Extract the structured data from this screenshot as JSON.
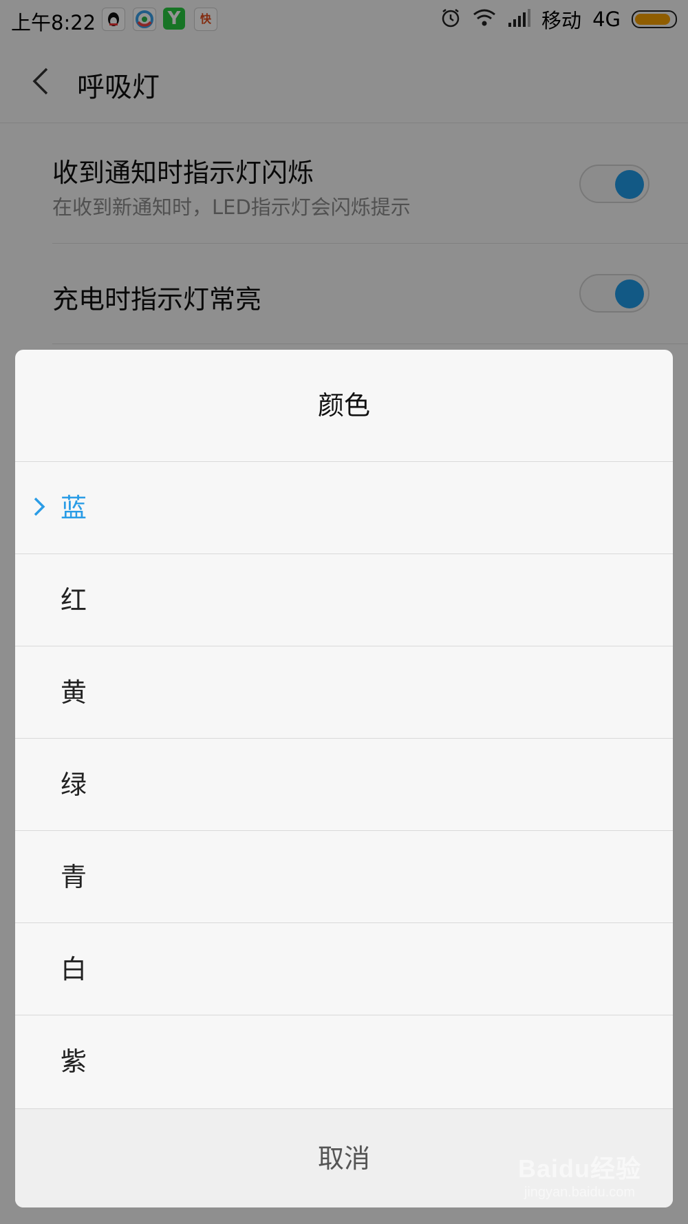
{
  "status_bar": {
    "time": "上午8:22",
    "carrier": "移动",
    "network": "4G",
    "icons": [
      "qq-icon",
      "news-icon",
      "y-app-icon",
      "kuaibao-icon",
      "alarm-icon",
      "wifi-icon",
      "signal-icon",
      "battery-icon"
    ],
    "battery_color": "#f7a000"
  },
  "header": {
    "title": "呼吸灯"
  },
  "settings": [
    {
      "label": "收到通知时指示灯闪烁",
      "description": "在收到新通知时，LED指示灯会闪烁提示",
      "enabled": true
    },
    {
      "label": "充电时指示灯常亮",
      "enabled": true
    }
  ],
  "dialog": {
    "title": "颜色",
    "options": [
      "蓝",
      "红",
      "黄",
      "绿",
      "青",
      "白",
      "紫"
    ],
    "selected": "蓝",
    "cancel_label": "取消"
  },
  "watermark": {
    "logo": "Baidu经验",
    "url": "jingyan.baidu.com"
  },
  "colors": {
    "accent": "#2a9ce6",
    "toggle_on": "#1f99e6"
  }
}
